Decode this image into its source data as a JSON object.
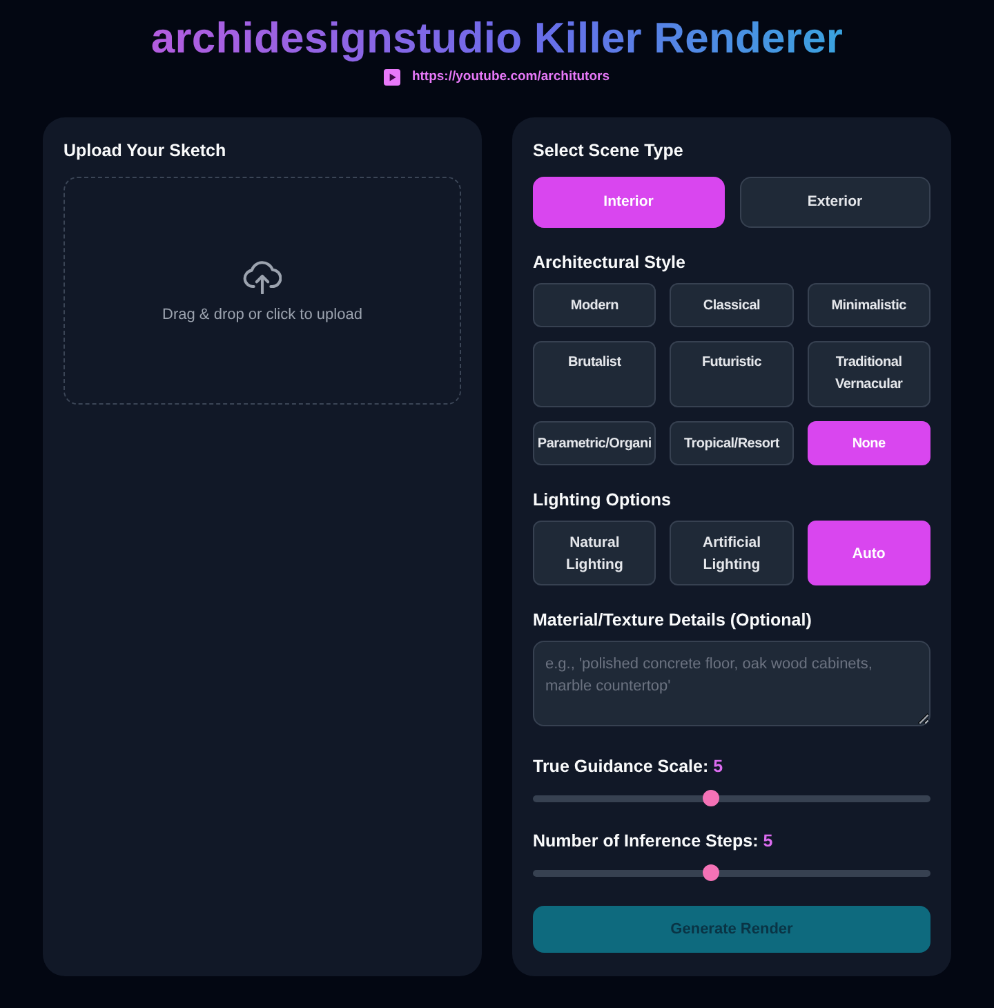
{
  "header": {
    "title": "archidesignstudio Killer Renderer",
    "link": "https://youtube.com/architutors"
  },
  "upload_panel": {
    "title": "Upload Your Sketch",
    "dropzone_text": "Drag & drop or click to upload"
  },
  "settings_panel": {
    "scene_type": {
      "label": "Select Scene Type",
      "options": [
        {
          "label": "Interior",
          "selected": true
        },
        {
          "label": "Exterior",
          "selected": false
        }
      ]
    },
    "architectural_style": {
      "label": "Architectural Style",
      "options": [
        {
          "label": "Modern",
          "selected": false
        },
        {
          "label": "Classical",
          "selected": false
        },
        {
          "label": "Minimalistic",
          "selected": false
        },
        {
          "label": "Brutalist",
          "selected": false
        },
        {
          "label": "Futuristic",
          "selected": false
        },
        {
          "label": "Traditional Vernacular",
          "selected": false
        },
        {
          "label": "Parametric/Organi",
          "selected": false
        },
        {
          "label": "Tropical/Resort",
          "selected": false
        },
        {
          "label": "None",
          "selected": true
        }
      ]
    },
    "lighting": {
      "label": "Lighting Options",
      "options": [
        {
          "label": "Natural Lighting",
          "selected": false
        },
        {
          "label": "Artificial Lighting",
          "selected": false
        },
        {
          "label": "Auto",
          "selected": true
        }
      ]
    },
    "material_details": {
      "label": "Material/Texture Details (Optional)",
      "placeholder": "e.g., 'polished concrete floor, oak wood cabinets, marble countertop'"
    },
    "sliders": [
      {
        "label": "True Guidance Scale:",
        "value": "5",
        "level": 0.444
      },
      {
        "label": "Number of Inference Steps:",
        "value": "5",
        "level": 0.444
      }
    ],
    "generate_button": {
      "label": "Generate Render",
      "disabled": true
    }
  }
}
